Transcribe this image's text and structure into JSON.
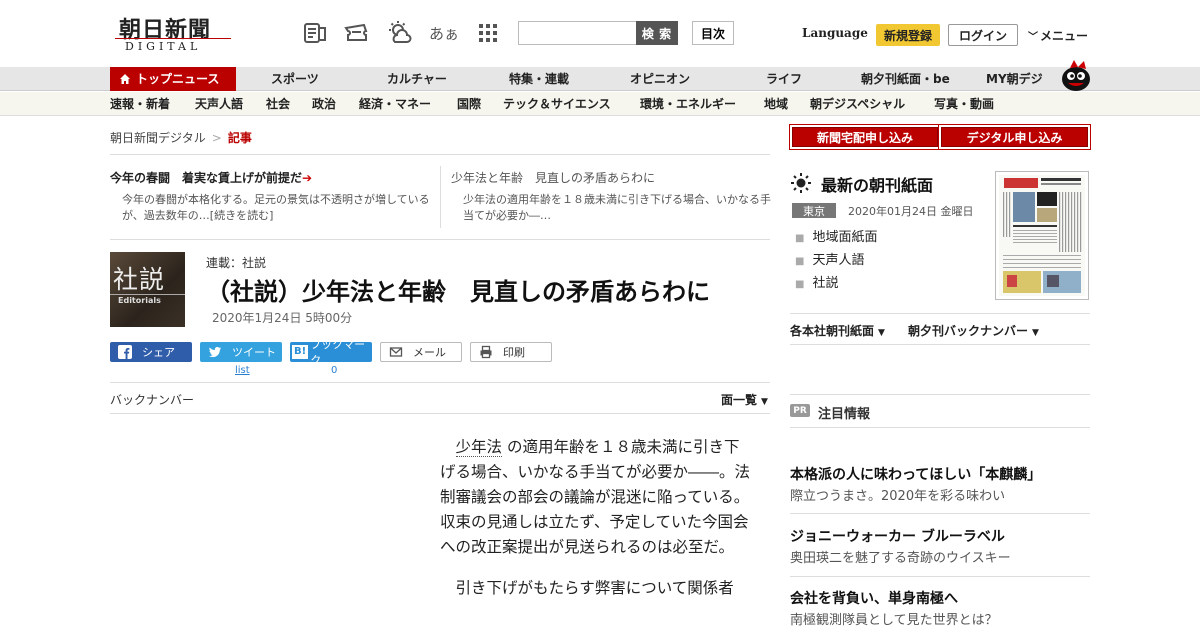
{
  "header": {
    "logo_main": "朝日新聞",
    "logo_sub": "DIGITAL",
    "search_button": "検 索",
    "toc_button": "目次",
    "kana_icon_text": "あぁ",
    "language": "Language",
    "signup": "新規登録",
    "login": "ログイン",
    "menu": "メニュー"
  },
  "nav_primary": [
    "トップニュース",
    "スポーツ",
    "カルチャー",
    "特集・連載",
    "オピニオン",
    "ライフ",
    "朝夕刊紙面・be",
    "MY朝デジ"
  ],
  "nav_secondary": [
    "速報・新着",
    "天声人語",
    "社会",
    "政治",
    "経済・マネー",
    "国際",
    "テック＆サイエンス",
    "環境・エネルギー",
    "地域",
    "朝デジスペシャル",
    "写真・動画"
  ],
  "breadcrumb": {
    "home": "朝日新聞デジタル",
    "sep": ">",
    "current": "記事"
  },
  "teasers": [
    {
      "title": "今年の春闘　着実な賃上げが前提だ",
      "arrow": "➔",
      "body": "今年の春闘が本格化する。足元の景気は不透明さが増しているが、過去数年の…",
      "more": "[続きを読む]"
    },
    {
      "title": "少年法と年齢　見直しの矛盾あらわに",
      "body": "少年法の適用年齢を１８歳未満に引き下げる場合、いかなる手当てが必要か―…"
    }
  ],
  "article": {
    "thumb_kanji": "社説",
    "thumb_en": "Editorials",
    "series": "連載：社説",
    "headline": "（社説）少年法と年齢　見直しの矛盾あらわに",
    "date": "2020年1月24日 5時00分",
    "share": {
      "facebook": "シェア",
      "twitter": "ツイート",
      "twitter_count": "list",
      "hatena_badge": "B!",
      "hatena": "ブックマーク",
      "hatena_count": "0",
      "mail": "メール",
      "print": "印刷"
    },
    "backnumber": "バックナンバー",
    "page_list": "面一覧",
    "keyword": "少年法",
    "paragraph1_rest": "の適用年齢を１８歳未満に引き下げる場合、いかなる手当てが必要か――。法制審議会の部会の議論が混迷に陥っている。収束の見通しは立たず、予定していた今国会への改正案提出が見送られるのは必至だ。",
    "paragraph2": "引き下げがもたらす弊害について関係者"
  },
  "sidebar": {
    "order_paper": "新聞宅配申し込み",
    "order_digital": "デジタル申し込み",
    "latest_title": "最新の朝刊紙面",
    "location": "東京",
    "paper_date": "2020年01月24日 金曜日",
    "paper_links": [
      "地域面紙面",
      "天声人語",
      "社説"
    ],
    "dropdown_regional": "各本社朝刊紙面",
    "dropdown_backnumber": "朝夕刊バックナンバー",
    "pr_tag": "PR",
    "pr_title": "注目情報",
    "promos": [
      {
        "title": "本格派の人に味わってほしい「本麒麟」",
        "sub": "際立つうまさ。2020年を彩る味わい"
      },
      {
        "title": "ジョニーウォーカー ブルーラベル",
        "sub": "奥田瑛二を魅了する奇跡のウイスキー"
      },
      {
        "title": "会社を背負い、単身南極へ",
        "sub": "南極観測隊員として見た世界とは？"
      }
    ]
  },
  "colors": {
    "brand_red": "#bb0000",
    "signup_yellow": "#f2c832",
    "facebook": "#2f5daa",
    "twitter": "#33a2df",
    "hatena": "#2a8fd6"
  }
}
